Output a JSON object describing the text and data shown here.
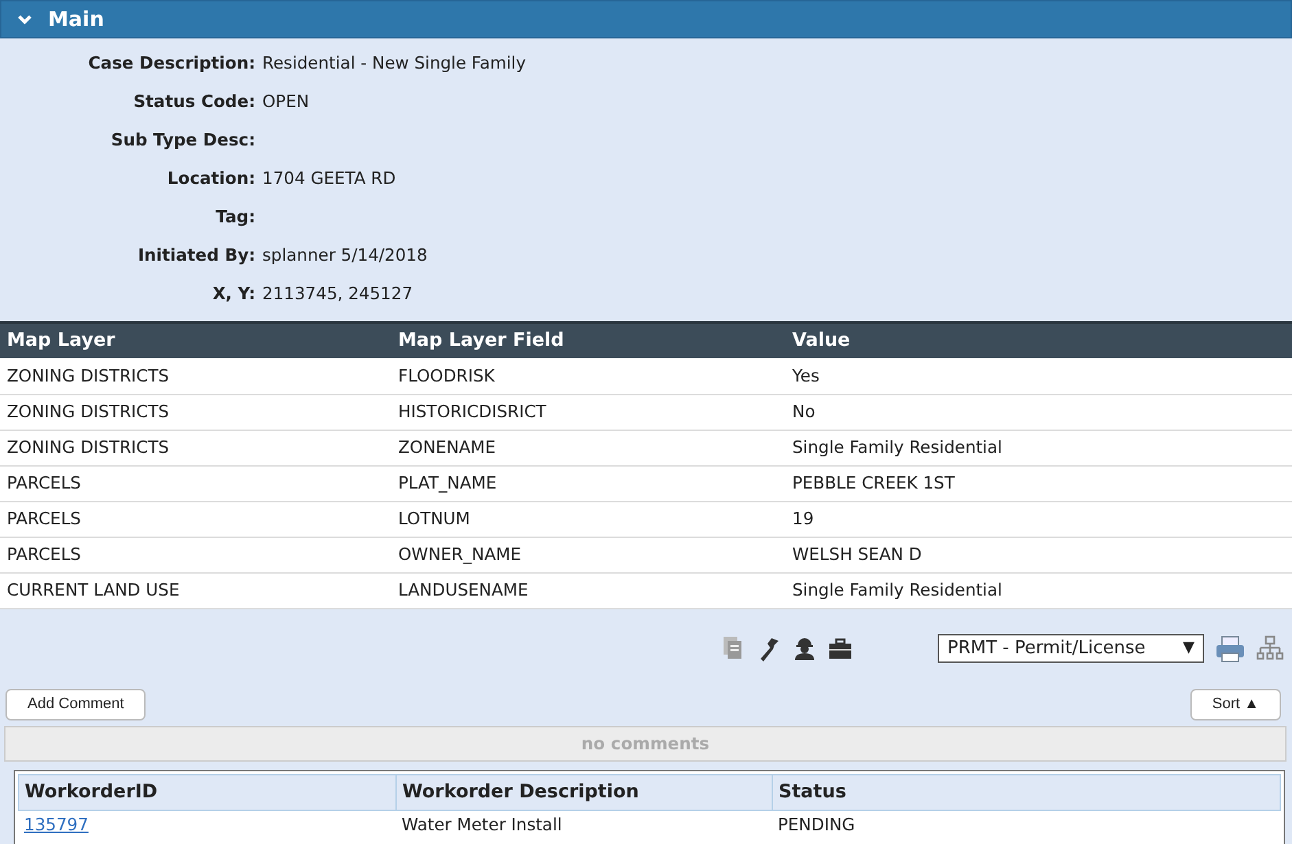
{
  "section": {
    "title": "Main",
    "expanded": true
  },
  "fields": [
    {
      "label": "Case Description:",
      "value": "Residential - New Single Family"
    },
    {
      "label": "Status Code:",
      "value": "OPEN"
    },
    {
      "label": "Sub Type Desc:"
    },
    {
      "label": "Location:",
      "value": "1704 GEETA RD"
    },
    {
      "label": "Tag:"
    },
    {
      "label": "Initiated By:",
      "value": "splanner 5/14/2018"
    },
    {
      "label": "X, Y:",
      "value": "2113745, 245127"
    }
  ],
  "map_table": {
    "columns": [
      "Map Layer",
      "Map Layer Field",
      "Value"
    ],
    "rows": [
      [
        "ZONING DISTRICTS",
        "FLOODRISK",
        "Yes"
      ],
      [
        "ZONING DISTRICTS",
        "HISTORICDISRICT",
        "No"
      ],
      [
        "ZONING DISTRICTS",
        "ZONENAME",
        "Single Family Residential"
      ],
      [
        "PARCELS",
        "PLAT_NAME",
        "PEBBLE CREEK 1ST"
      ],
      [
        "PARCELS",
        "LOTNUM",
        "19"
      ],
      [
        "PARCELS",
        "OWNER_NAME",
        "WELSH SEAN D"
      ],
      [
        "CURRENT LAND USE",
        "LANDUSENAME",
        "Single Family Residential"
      ]
    ]
  },
  "toolbar": {
    "dropdown_value": "PRMT - Permit/License",
    "dropdown_caret": "▼"
  },
  "comments": {
    "add_button": "Add Comment",
    "sort_button": "Sort ▲",
    "empty_text": "no comments"
  },
  "workorders": {
    "columns": [
      "WorkorderID",
      "Workorder Description",
      "Status"
    ],
    "rows": [
      {
        "id": "135797",
        "description": "Water Meter Install",
        "status": "PENDING"
      }
    ]
  }
}
